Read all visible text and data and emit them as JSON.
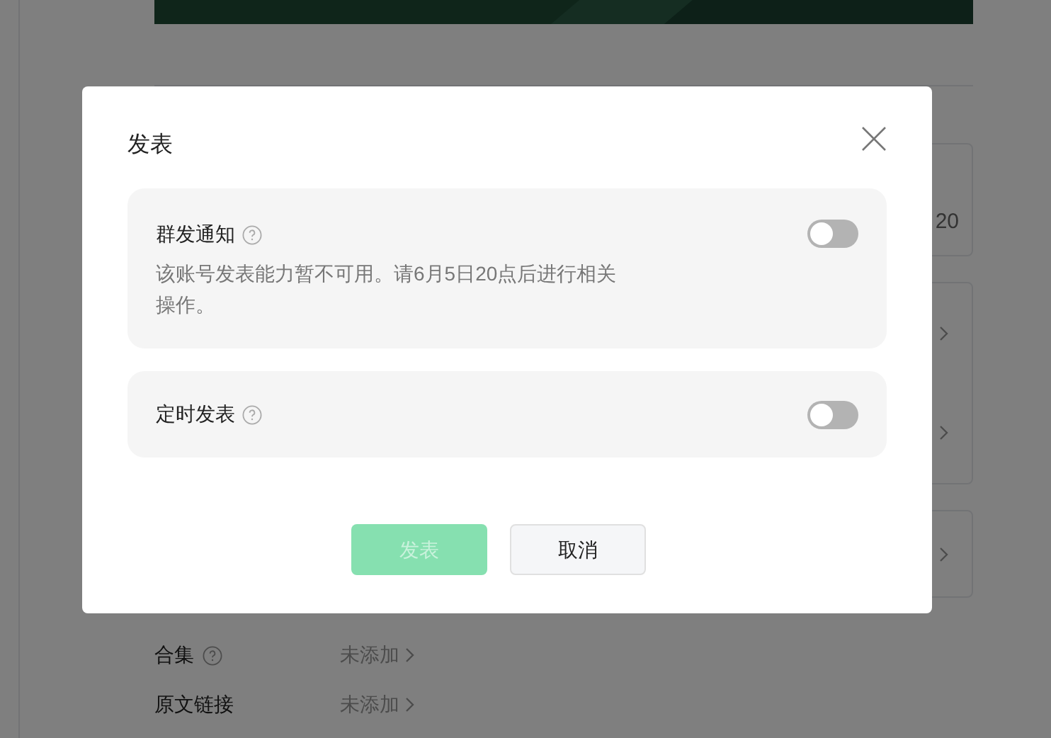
{
  "page": {
    "cards": [
      {
        "kind": "value",
        "text": "20"
      },
      {
        "kind": "double"
      },
      {
        "kind": "single"
      }
    ],
    "rows": [
      {
        "label": "合集",
        "help": true,
        "value": "未添加"
      },
      {
        "label": "原文链接",
        "help": false,
        "value": "未添加"
      }
    ]
  },
  "dialog": {
    "title": "发表",
    "options": [
      {
        "label": "群发通知",
        "note": "该账号发表能力暂不可用。请6月5日20点后进行相关操作。",
        "on": false
      },
      {
        "label": "定时发表",
        "on": false
      }
    ],
    "buttons": [
      {
        "kind": "primary",
        "label": "发表",
        "disabled": true
      },
      {
        "kind": "secondary",
        "label": "取消",
        "disabled": false
      }
    ]
  }
}
